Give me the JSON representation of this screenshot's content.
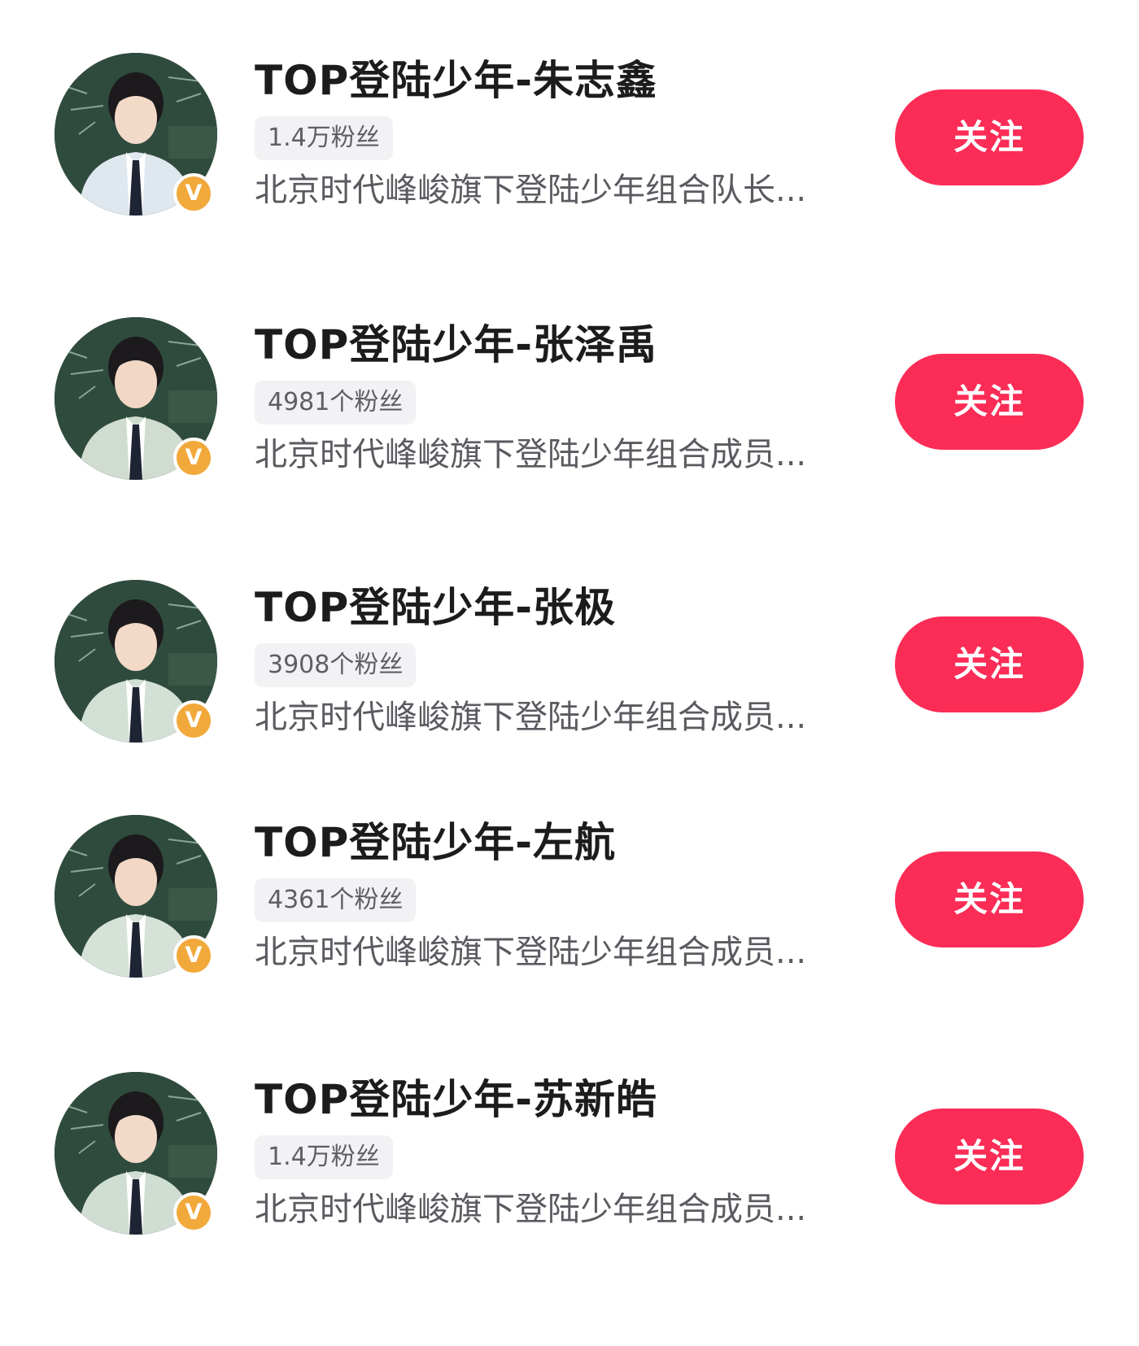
{
  "accent_color": "#fb2c56",
  "badge_color": "#f2a93b",
  "accounts": [
    {
      "name": "TOP登陆少年-朱志鑫",
      "fans": "1.4万粉丝",
      "bio": "北京时代峰峻旗下登陆少年组合队长...",
      "follow_label": "关注",
      "badge": "V",
      "avatar_icon": "avatar-portrait"
    },
    {
      "name": "TOP登陆少年-张泽禹",
      "fans": "4981个粉丝",
      "bio": "北京时代峰峻旗下登陆少年组合成员...",
      "follow_label": "关注",
      "badge": "V",
      "avatar_icon": "avatar-portrait"
    },
    {
      "name": "TOP登陆少年-张极",
      "fans": "3908个粉丝",
      "bio": "北京时代峰峻旗下登陆少年组合成员...",
      "follow_label": "关注",
      "badge": "V",
      "avatar_icon": "avatar-portrait"
    },
    {
      "name": "TOP登陆少年-左航",
      "fans": "4361个粉丝",
      "bio": "北京时代峰峻旗下登陆少年组合成员...",
      "follow_label": "关注",
      "badge": "V",
      "avatar_icon": "avatar-portrait"
    },
    {
      "name": "TOP登陆少年-苏新皓",
      "fans": "1.4万粉丝",
      "bio": "北京时代峰峻旗下登陆少年组合成员...",
      "follow_label": "关注",
      "badge": "V",
      "avatar_icon": "avatar-portrait"
    }
  ]
}
